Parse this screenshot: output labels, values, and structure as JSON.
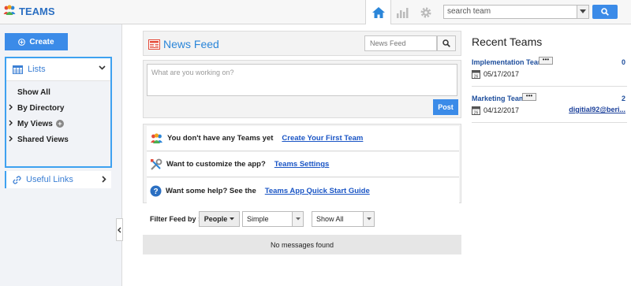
{
  "app": {
    "title": "TEAMS"
  },
  "topbar": {
    "search_placeholder": "search team"
  },
  "sidebar": {
    "create_label": "Create",
    "lists_label": "Lists",
    "items": [
      {
        "label": "Show All",
        "has_caret": false
      },
      {
        "label": "By Directory",
        "has_caret": true
      },
      {
        "label": "My Views",
        "has_caret": true,
        "has_plus": true
      },
      {
        "label": "Shared Views",
        "has_caret": true
      }
    ],
    "useful_links_label": "Useful Links"
  },
  "feed": {
    "title": "News Feed",
    "search_placeholder": "News Feed",
    "compose_placeholder": "What are you working on?",
    "post_label": "Post",
    "tips": [
      {
        "text": "You don't have any Teams yet",
        "link": "Create Your First Team"
      },
      {
        "text": "Want to customize the app?",
        "link": "Teams Settings"
      },
      {
        "text": "Want some help? See the",
        "link": "Teams App Quick Start Guide"
      }
    ],
    "filter_label": "Filter Feed by :",
    "filter_people": "People",
    "filter_type": "Simple",
    "filter_scope": "Show All",
    "empty_message": "No messages found"
  },
  "recent": {
    "title": "Recent Teams",
    "dots": "•••",
    "teams": [
      {
        "name": "Implementation Team",
        "count": "0",
        "date": "05/17/2017",
        "owner": ""
      },
      {
        "name": "Marketing Team",
        "count": "2",
        "date": "04/12/2017",
        "owner": "digitial92@beri..."
      }
    ]
  },
  "icons": {
    "calendar_day": "26"
  },
  "colors": {
    "accent": "#3b8be8",
    "brand": "#2b6fc2",
    "link": "#1a55c5"
  }
}
